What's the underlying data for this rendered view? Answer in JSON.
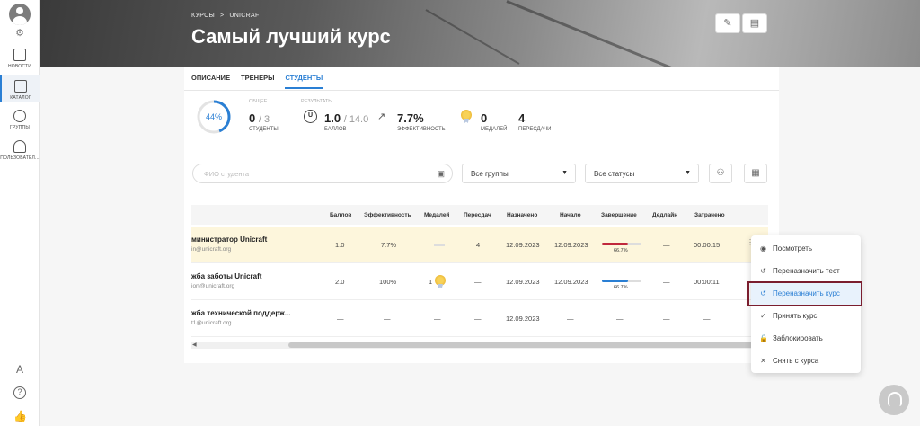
{
  "sidebar": {
    "items": [
      {
        "label": "НОВОСТИ",
        "icon": "news-icon"
      },
      {
        "label": "КАТАЛОГ",
        "icon": "catalog-icon"
      },
      {
        "label": "ГРУППЫ",
        "icon": "groups-icon"
      },
      {
        "label": "ПОЛЬЗОВАТЕЛ...",
        "icon": "users-icon"
      }
    ],
    "active_index": 1
  },
  "header": {
    "breadcrumb": [
      "КУРСЫ",
      ">",
      "UNICRAFT"
    ],
    "title": "Самый лучший курс"
  },
  "tabs": [
    "ОПИСАНИЕ",
    "ТРЕНЕРЫ",
    "СТУДЕНТЫ"
  ],
  "active_tab": 2,
  "stats": {
    "progress_label": "44%",
    "progress_fraction": 0.44,
    "general_caption": "ОБЩЕЕ",
    "results_caption": "РЕЗУЛЬТАТЫ",
    "students_value": "0",
    "students_total": "/ 3",
    "students_label": "СТУДЕНТЫ",
    "points_value": "1.0",
    "points_total": "/ 14.0",
    "points_label": "БАЛЛОВ",
    "efficiency_value": "7.7%",
    "efficiency_label": "ЭФФЕКТИВНОСТЬ",
    "medals_value": "0",
    "medals_label": "МЕДАЛЕЙ",
    "retakes_value": "4",
    "retakes_label": "ПЕРЕСДАЧИ"
  },
  "filters": {
    "search_placeholder": "ФИО студента",
    "groups_value": "Все группы",
    "status_value": "Все статусы"
  },
  "table": {
    "headers": [
      "Баллов",
      "Эффективность",
      "Медалей",
      "Пересдач",
      "Назначено",
      "Начало",
      "Завершение",
      "Дедлайн",
      "Затрачено"
    ],
    "rows": [
      {
        "name": "министратор Unicraft",
        "email": "in@unicraft.org",
        "points": "1.0",
        "efficiency": "7.7%",
        "medals": "",
        "retakes": "4",
        "assigned": "12.09.2023",
        "start": "12.09.2023",
        "completion": "66.7%",
        "completion_fraction": 0.667,
        "completion_color": "#c0283c",
        "deadline": "—",
        "spent": "00:00:15"
      },
      {
        "name": "жба заботы Unicraft",
        "email": "iort@unicraft.org",
        "points": "2.0",
        "efficiency": "100%",
        "medals": "1",
        "retakes": "—",
        "assigned": "12.09.2023",
        "start": "12.09.2023",
        "completion": "66.7%",
        "completion_fraction": 0.667,
        "completion_color": "#2a7fd4",
        "deadline": "—",
        "spent": "00:00:11"
      },
      {
        "name": "жба технической поддерж...",
        "email": "t1@unicraft.org",
        "points": "—",
        "efficiency": "—",
        "medals": "—",
        "retakes": "—",
        "assigned": "12.09.2023",
        "start": "—",
        "completion": "—",
        "completion_fraction": 0,
        "completion_color": "#ddd",
        "deadline": "—",
        "spent": "—"
      }
    ]
  },
  "context_menu": {
    "items": [
      {
        "label": "Посмотреть",
        "icon": "eye-icon",
        "glyph": "◉"
      },
      {
        "label": "Переназначить тест",
        "icon": "reassign-icon",
        "glyph": "↺"
      },
      {
        "label": "Переназначить курс",
        "icon": "reassign-icon",
        "glyph": "↺"
      },
      {
        "label": "Принять курс",
        "icon": "check-icon",
        "glyph": "✓"
      },
      {
        "label": "Заблокировать",
        "icon": "lock-icon",
        "glyph": "🔒"
      },
      {
        "label": "Снять с курса",
        "icon": "close-icon",
        "glyph": "✕"
      }
    ],
    "highlighted_index": 2
  },
  "colors": {
    "accent": "#2a7fd4",
    "highlight_row": "#fdf6dc",
    "outline": "#7b1e2e"
  }
}
